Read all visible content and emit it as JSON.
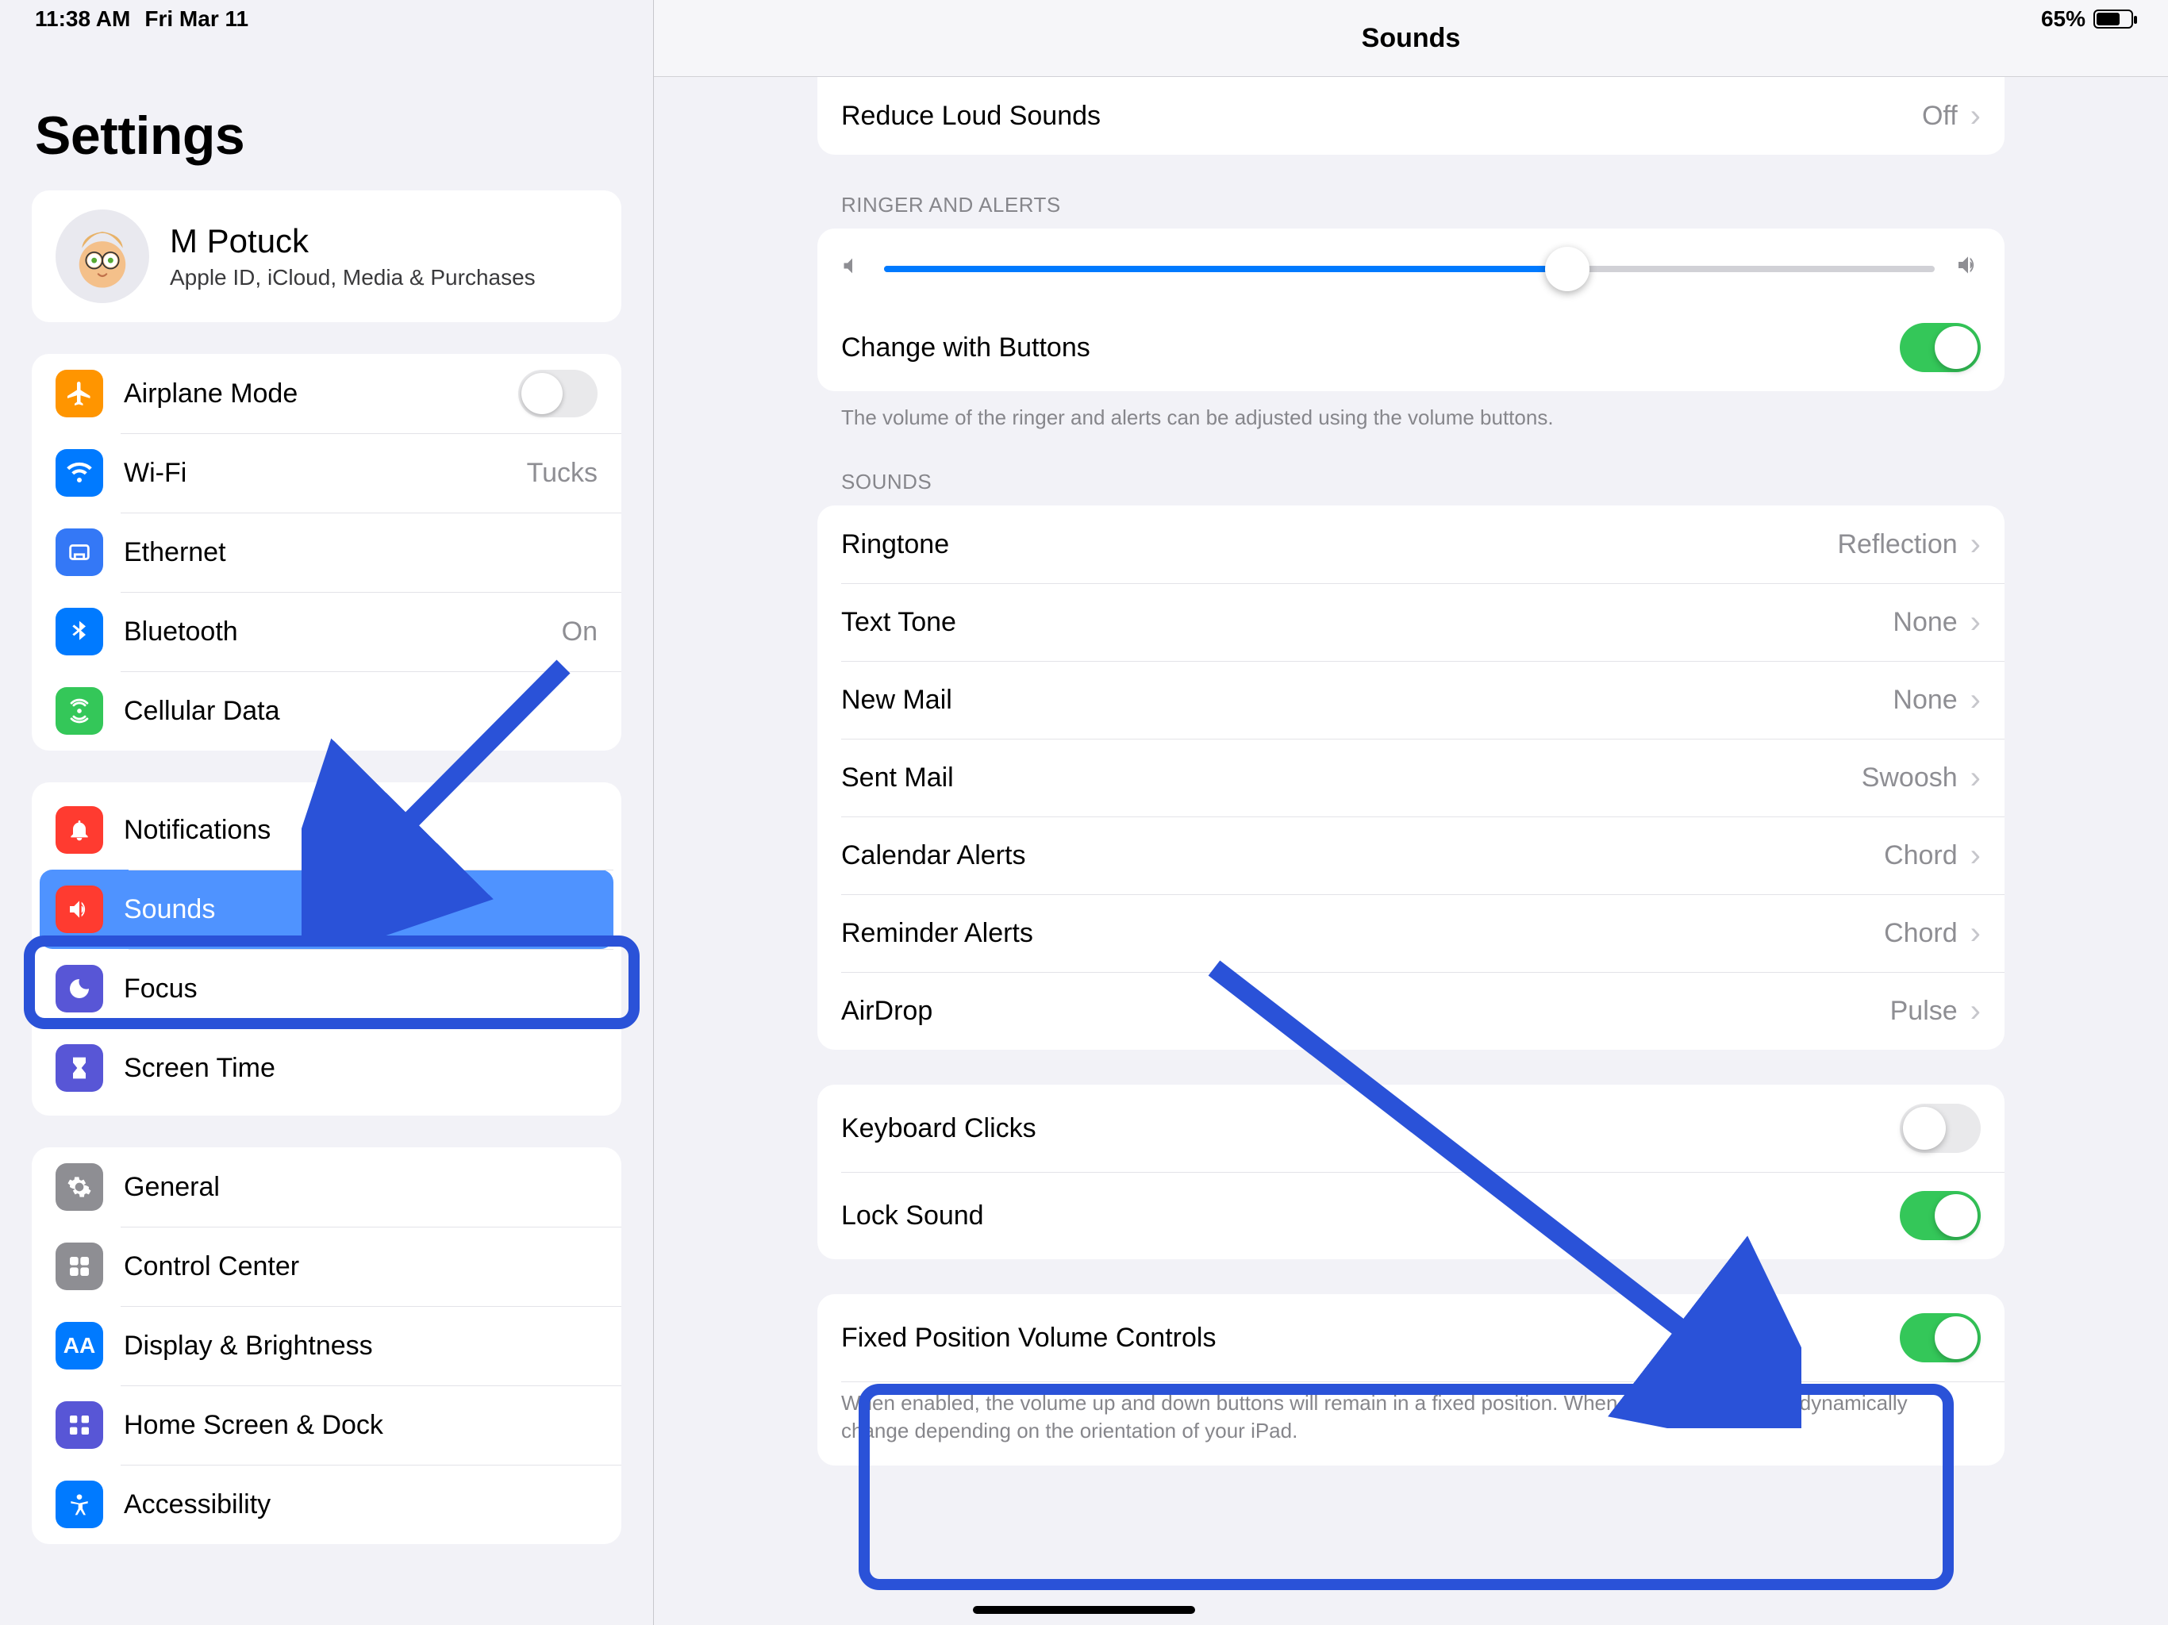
{
  "status": {
    "time": "11:38 AM",
    "date": "Fri Mar 11",
    "battery_pct": "65%"
  },
  "sidebar": {
    "title": "Settings",
    "profile": {
      "name": "M Potuck",
      "subtitle": "Apple ID, iCloud, Media & Purchases"
    },
    "group1": {
      "airplane": "Airplane Mode",
      "wifi": "Wi-Fi",
      "wifi_value": "Tucks",
      "ethernet": "Ethernet",
      "bluetooth": "Bluetooth",
      "bluetooth_value": "On",
      "cellular": "Cellular Data"
    },
    "group2": {
      "notifications": "Notifications",
      "sounds": "Sounds",
      "focus": "Focus",
      "screen_time": "Screen Time"
    },
    "group3": {
      "general": "General",
      "control_center": "Control Center",
      "display": "Display & Brightness",
      "home_screen": "Home Screen & Dock",
      "accessibility": "Accessibility"
    }
  },
  "detail": {
    "title": "Sounds",
    "reduce_loud_label": "Reduce Loud Sounds",
    "reduce_loud_value": "Off",
    "ringer_header": "RINGER AND ALERTS",
    "change_buttons_label": "Change with Buttons",
    "ringer_footer": "The volume of the ringer and alerts can be adjusted using the volume buttons.",
    "sounds_header": "SOUNDS",
    "sound_items": [
      {
        "label": "Ringtone",
        "value": "Reflection"
      },
      {
        "label": "Text Tone",
        "value": "None"
      },
      {
        "label": "New Mail",
        "value": "None"
      },
      {
        "label": "Sent Mail",
        "value": "Swoosh"
      },
      {
        "label": "Calendar Alerts",
        "value": "Chord"
      },
      {
        "label": "Reminder Alerts",
        "value": "Chord"
      },
      {
        "label": "AirDrop",
        "value": "Pulse"
      }
    ],
    "keyboard_clicks": "Keyboard Clicks",
    "lock_sound": "Lock Sound",
    "fpvc_label": "Fixed Position Volume Controls",
    "fpvc_footer": "When enabled, the volume up and down buttons will remain in a fixed position. When off, the buttons will dynamically change depending on the orientation of your iPad.",
    "ringer_slider_value": 0.65
  }
}
